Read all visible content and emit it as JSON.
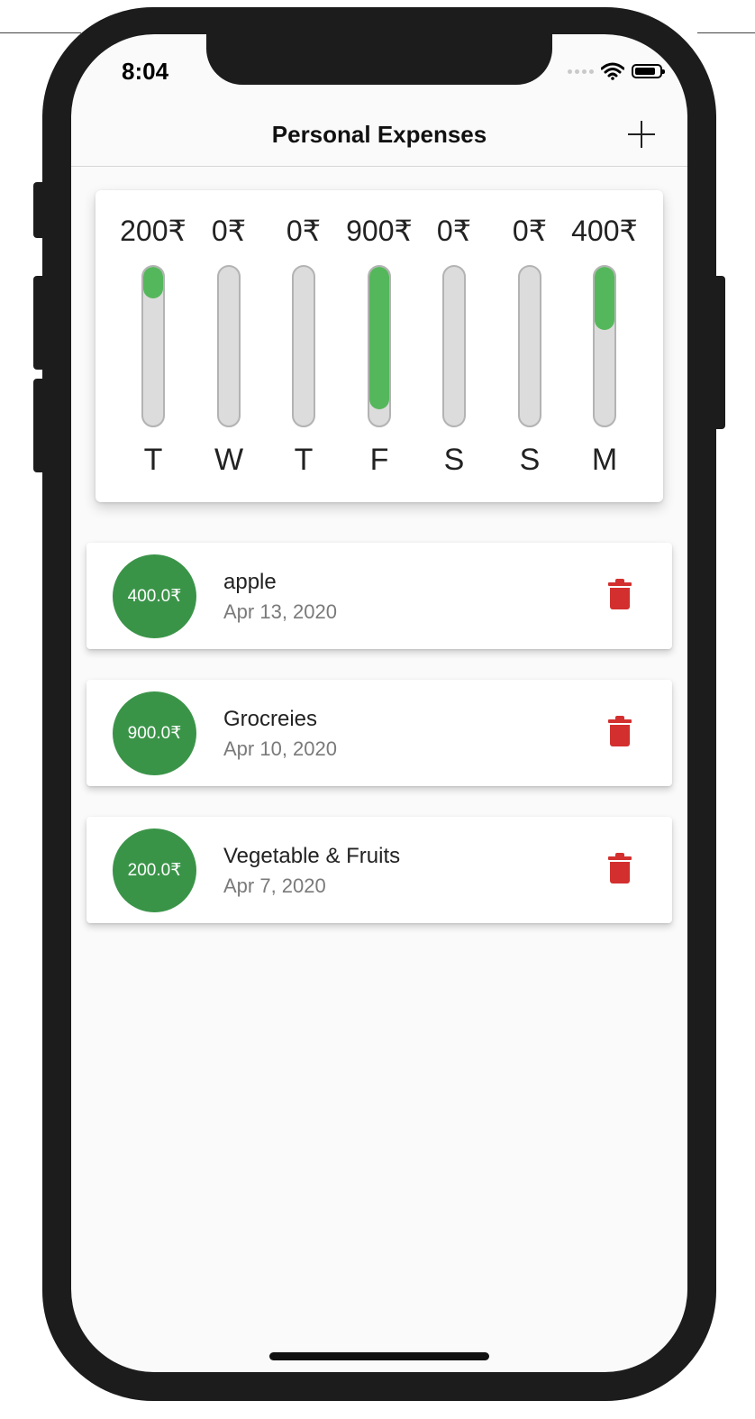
{
  "status_bar": {
    "time": "8:04"
  },
  "navbar": {
    "title": "Personal Expenses",
    "add_icon": "plus-icon"
  },
  "weekly_chart": [
    {
      "day": "T",
      "amount": "200₹",
      "fill_fraction": 0.2
    },
    {
      "day": "W",
      "amount": "0₹",
      "fill_fraction": 0
    },
    {
      "day": "T",
      "amount": "0₹",
      "fill_fraction": 0
    },
    {
      "day": "F",
      "amount": "900₹",
      "fill_fraction": 0.9
    },
    {
      "day": "S",
      "amount": "0₹",
      "fill_fraction": 0
    },
    {
      "day": "S",
      "amount": "0₹",
      "fill_fraction": 0
    },
    {
      "day": "M",
      "amount": "400₹",
      "fill_fraction": 0.4
    }
  ],
  "transactions": [
    {
      "amount": "400.0₹",
      "title": "apple",
      "date": "Apr 13, 2020"
    },
    {
      "amount": "900.0₹",
      "title": "Grocreies",
      "date": "Apr 10, 2020"
    },
    {
      "amount": "200.0₹",
      "title": "Vegetable & Fruits",
      "date": "Apr 7, 2020"
    }
  ],
  "colors": {
    "bar_fill": "#55b75b",
    "avatar": "#3a9448",
    "delete": "#d32f2f"
  }
}
